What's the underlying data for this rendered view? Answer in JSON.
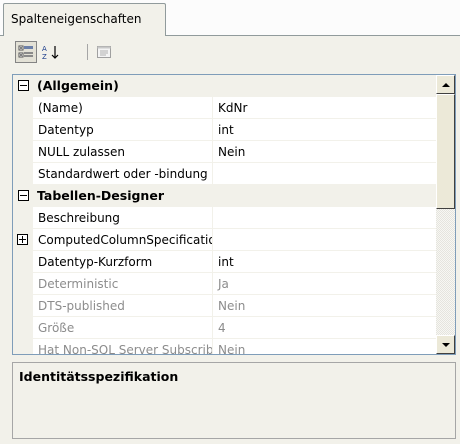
{
  "tab": {
    "label": "Spalteneigenschaften"
  },
  "toolbar": {
    "buttons": [
      {
        "icon": "categorized-icon",
        "pressed": true
      },
      {
        "icon": "alphabetical-sort-icon",
        "pressed": false
      },
      {
        "icon": "property-pages-icon",
        "pressed": false
      }
    ]
  },
  "grid": {
    "categories": [
      {
        "label": "(Allgemein)",
        "expanded": true,
        "properties": [
          {
            "name": "(Name)",
            "value": "KdNr"
          },
          {
            "name": "Datentyp",
            "value": "int"
          },
          {
            "name": "NULL zulassen",
            "value": "Nein"
          },
          {
            "name": "Standardwert oder -bindung",
            "value": ""
          }
        ]
      },
      {
        "label": "Tabellen-Designer",
        "expanded": true,
        "properties": [
          {
            "name": "Beschreibung",
            "value": ""
          },
          {
            "name": "ComputedColumnSpecification",
            "value": "",
            "expandable": true
          },
          {
            "name": "Datentyp-Kurzform",
            "value": "int"
          },
          {
            "name": "Deterministic",
            "value": "Ja",
            "readonly": true
          },
          {
            "name": "DTS-published",
            "value": "Nein",
            "readonly": true
          },
          {
            "name": "Größe",
            "value": "4",
            "readonly": true
          },
          {
            "name": "Hat Non-SQL Server Subscriber",
            "value": "Nein",
            "readonly": true
          }
        ]
      }
    ]
  },
  "description": {
    "title": "Identitätsspezifikation",
    "text": ""
  }
}
